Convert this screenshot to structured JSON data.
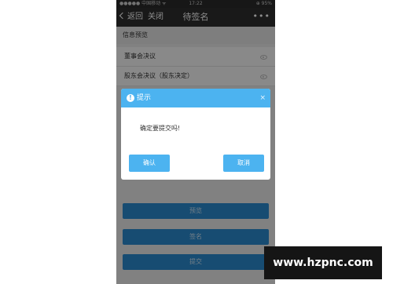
{
  "statusbar": {
    "carrier": "●●●●● 中国移动 ᯤ",
    "time": "17:22",
    "right": "⊕ 95%"
  },
  "navbar": {
    "back_label": "返回",
    "close_label": "关闭",
    "title": "待签名",
    "more": "•••"
  },
  "section": {
    "title": "信息预览"
  },
  "list": {
    "items": [
      {
        "label": "董事会决议"
      },
      {
        "label": "股东会决议（股东决定）"
      }
    ]
  },
  "actions": {
    "preview": "预览",
    "sign": "签名",
    "submit": "提交"
  },
  "dialog": {
    "title": "提示",
    "close_symbol": "×",
    "message": "确定要提交吗!",
    "confirm": "确认",
    "cancel": "取消"
  },
  "watermark": {
    "text": "www.hzpnc.com"
  }
}
